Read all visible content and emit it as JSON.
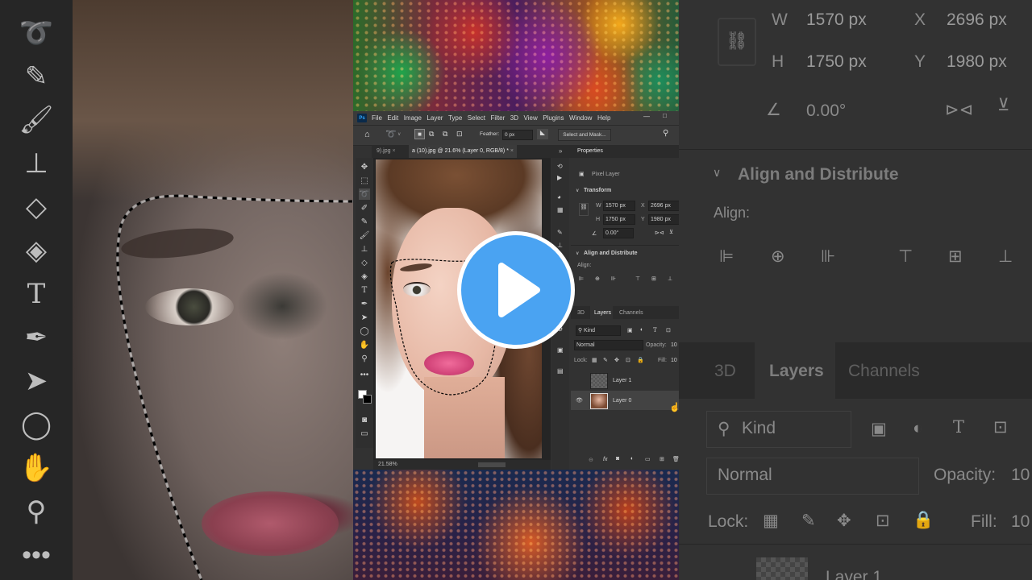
{
  "window": {
    "menu": [
      "File",
      "Edit",
      "Image",
      "Layer",
      "Type",
      "Select",
      "Filter",
      "3D",
      "View",
      "Plugins",
      "Window",
      "Help"
    ],
    "options": {
      "feather_label": "Feather:",
      "feather_value": "0 px",
      "select_mask": "Select and Mask..."
    },
    "tabs": [
      "9).jpg",
      "a (10).jpg @ 21.6% (Layer 0, RGB/8) *"
    ],
    "zoom": "21.58%"
  },
  "properties": {
    "title": "Properties",
    "kind": "Pixel Layer",
    "transform_label": "Transform",
    "w_label": "W",
    "w": "1570 px",
    "x_label": "X",
    "x": "2696 px",
    "h_label": "H",
    "h": "1750 px",
    "y_label": "Y",
    "y": "1980 px",
    "angle": "0.00°",
    "align_title": "Align and Distribute",
    "align_label": "Align:"
  },
  "layers_panel": {
    "tabs": [
      "3D",
      "Layers",
      "Channels"
    ],
    "kind": "Kind",
    "blend": "Normal",
    "opacity_label": "Opacity:",
    "opacity": "10",
    "lock_label": "Lock:",
    "fill_label": "Fill:",
    "fill": "10",
    "layers": [
      "Layer 1",
      "Layer 0"
    ]
  },
  "zoomed_right": {
    "w_label": "W",
    "w": "1570 px",
    "x_label": "X",
    "x": "2696 px",
    "h_label": "H",
    "h": "1750 px",
    "y_label": "Y",
    "y": "1980 px",
    "angle": "0.00°",
    "align_title": "Align and Distribute",
    "align_label": "Align:",
    "tabs": [
      "3D",
      "Layers",
      "Channels"
    ],
    "kind": "Kind",
    "blend": "Normal",
    "opacity_label": "Opacity:",
    "opacity": "10",
    "lock_label": "Lock:",
    "fill_label": "Fill:",
    "fill": "10",
    "layer": "Layer 1"
  },
  "colors": {
    "accent": "#31a8ff",
    "play": "#4aa3f2",
    "panel": "#323232"
  }
}
